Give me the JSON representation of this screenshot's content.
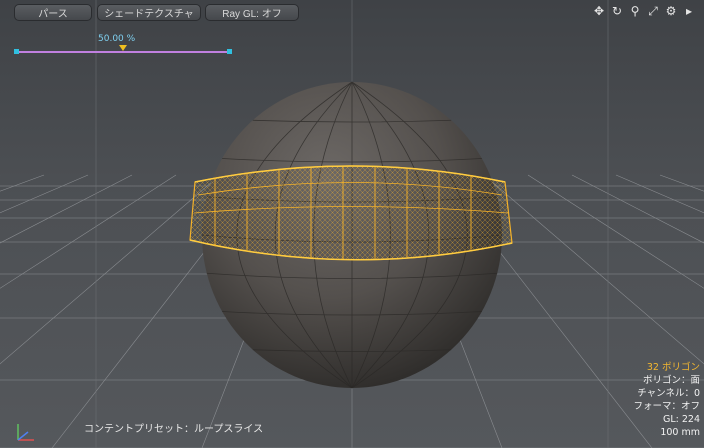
{
  "toolbar": {
    "view_label": "パース",
    "shading_label": "シェードテクスチャ",
    "raygl_label": "Ray GL: オフ"
  },
  "viewport_icons": [
    "move-view-icon",
    "rotate-view-icon",
    "zoom-view-icon",
    "maximize-icon",
    "settings-icon",
    "arrow-right-icon"
  ],
  "slider": {
    "label": "50.00 %",
    "value_percent": 50
  },
  "stats": {
    "selection": "32 ポリゴン",
    "mode": "ポリゴン：面",
    "channel": "チャンネル：0",
    "format": "フォーマ：オフ",
    "gl": "GL: 224",
    "scale": "100 mm"
  },
  "preset": "コンテントプリセット：ループスライス",
  "colors": {
    "selection": "#f4b22a",
    "mesh": "#57534f",
    "background": "#4a4d51"
  }
}
